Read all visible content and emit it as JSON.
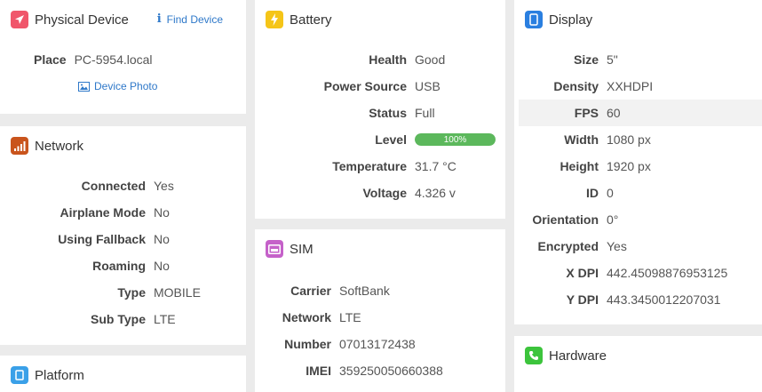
{
  "physical_device": {
    "title": "Physical Device",
    "find_label": "Find Device",
    "place_label": "Place",
    "place_value": "PC-5954.local",
    "photo_label": "Device Photo",
    "icon": "paper-plane-icon",
    "accent": "#f0566b"
  },
  "network": {
    "title": "Network",
    "icon": "signal-bars-icon",
    "accent": "#c9541c",
    "rows": [
      {
        "label": "Connected",
        "value": "Yes"
      },
      {
        "label": "Airplane Mode",
        "value": "No"
      },
      {
        "label": "Using Fallback",
        "value": "No"
      },
      {
        "label": "Roaming",
        "value": "No"
      },
      {
        "label": "Type",
        "value": "MOBILE"
      },
      {
        "label": "Sub Type",
        "value": "LTE"
      }
    ]
  },
  "platform": {
    "title": "Platform",
    "icon": "platform-icon",
    "accent": "#3aa0e8"
  },
  "battery": {
    "title": "Battery",
    "icon": "lightning-icon",
    "accent": "#f5c518",
    "rows": [
      {
        "label": "Health",
        "value": "Good"
      },
      {
        "label": "Power Source",
        "value": "USB"
      },
      {
        "label": "Status",
        "value": "Full"
      },
      {
        "label": "Level",
        "value": "100%"
      },
      {
        "label": "Temperature",
        "value": "31.7 °C"
      },
      {
        "label": "Voltage",
        "value": "4.326 v"
      }
    ],
    "level_fraction": 1.0
  },
  "sim": {
    "title": "SIM",
    "icon": "sim-card-icon",
    "accent": "#c561c9",
    "rows": [
      {
        "label": "Carrier",
        "value": "SoftBank"
      },
      {
        "label": "Network",
        "value": "LTE"
      },
      {
        "label": "Number",
        "value": "07013172438"
      },
      {
        "label": "IMEI",
        "value": "359250050660388"
      }
    ]
  },
  "display": {
    "title": "Display",
    "icon": "phone-icon",
    "accent": "#2a7fe0",
    "rows": [
      {
        "label": "Size",
        "value": "5\""
      },
      {
        "label": "Density",
        "value": "XXHDPI"
      },
      {
        "label": "FPS",
        "value": "60"
      },
      {
        "label": "Width",
        "value": "1080 px"
      },
      {
        "label": "Height",
        "value": "1920 px"
      },
      {
        "label": "ID",
        "value": "0"
      },
      {
        "label": "Orientation",
        "value": "0°"
      },
      {
        "label": "Encrypted",
        "value": "Yes"
      },
      {
        "label": "X DPI",
        "value": "442.45098876953125"
      },
      {
        "label": "Y DPI",
        "value": "443.3450012207031"
      }
    ]
  },
  "hardware": {
    "title": "Hardware",
    "icon": "phone-handset-icon",
    "accent": "#3cc43c"
  }
}
